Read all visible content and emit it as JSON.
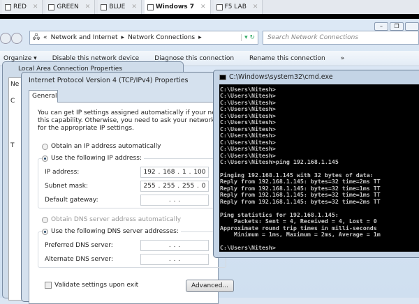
{
  "vm_tabs": [
    {
      "label": "RED"
    },
    {
      "label": "GREEN"
    },
    {
      "label": "BLUE"
    },
    {
      "label": "Windows 7",
      "active": true
    },
    {
      "label": "F5 LAB"
    }
  ],
  "explorer": {
    "breadcrumb": [
      "«",
      "Network and Internet",
      "▸",
      "Network Connections",
      "▸"
    ],
    "search_placeholder": "Search Network Connections",
    "toolbar": [
      "Organize ▾",
      "Disable this network device",
      "Diagnose this connection",
      "Rename this connection",
      "»"
    ]
  },
  "lacp": {
    "title": "Local Area Connection Properties",
    "close": "✕",
    "frag": [
      "Ne",
      "C",
      "T"
    ]
  },
  "ipv4": {
    "title": "Internet Protocol Version 4 (TCP/IPv4) Properties",
    "tab": "General",
    "desc": [
      "You can get IP settings assigned automatically if your network supp",
      "this capability. Otherwise, you need to ask your network administra",
      "for the appropriate IP settings."
    ],
    "auto_ip": "Obtain an IP address automatically",
    "manual_ip": "Use the following IP address:",
    "ip_label": "IP address:",
    "ip_value": "192 . 168 .  1  . 100",
    "mask_label": "Subnet mask:",
    "mask_value": "255 . 255 . 255 .  0",
    "gw_label": "Default gateway:",
    "gw_value": ".     .     .",
    "auto_dns": "Obtain DNS server address automatically",
    "manual_dns": "Use the following DNS server addresses:",
    "pdns_label": "Preferred DNS server:",
    "pdns_value": ".     .     .",
    "adns_label": "Alternate DNS server:",
    "adns_value": ".     .     .",
    "validate": "Validate settings upon exit",
    "advanced": "Advanced..."
  },
  "cmd": {
    "title": "C:\\Windows\\system32\\cmd.exe",
    "output": "C:\\Users\\Nitesh>\nC:\\Users\\Nitesh>\nC:\\Users\\Nitesh>\nC:\\Users\\Nitesh>\nC:\\Users\\Nitesh>\nC:\\Users\\Nitesh>\nC:\\Users\\Nitesh>\nC:\\Users\\Nitesh>\nC:\\Users\\Nitesh>\nC:\\Users\\Nitesh>\nC:\\Users\\Nitesh>\nC:\\Users\\Nitesh>ping 192.168.1.145\n\nPinging 192.168.1.145 with 32 bytes of data:\nReply from 192.168.1.145: bytes=32 time=2ms TT\nReply from 192.168.1.145: bytes=32 time=1ms TT\nReply from 192.168.1.145: bytes=32 time=1ms TT\nReply from 192.168.1.145: bytes=32 time=2ms TT\n\nPing statistics for 192.168.1.145:\n    Packets: Sent = 4, Received = 4, Lost = 0\nApproximate round trip times in milli-seconds\n    Minimum = 1ms, Maximum = 2ms, Average = 1m\n\nC:\\Users\\Nitesh>"
  }
}
